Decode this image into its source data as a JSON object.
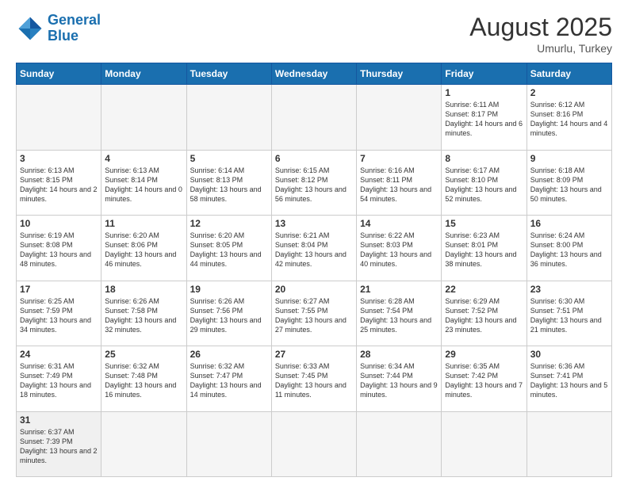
{
  "header": {
    "logo_general": "General",
    "logo_blue": "Blue",
    "month_year": "August 2025",
    "location": "Umurlu, Turkey"
  },
  "days_of_week": [
    "Sunday",
    "Monday",
    "Tuesday",
    "Wednesday",
    "Thursday",
    "Friday",
    "Saturday"
  ],
  "weeks": [
    [
      {
        "day": "",
        "info": ""
      },
      {
        "day": "",
        "info": ""
      },
      {
        "day": "",
        "info": ""
      },
      {
        "day": "",
        "info": ""
      },
      {
        "day": "",
        "info": ""
      },
      {
        "day": "1",
        "info": "Sunrise: 6:11 AM\nSunset: 8:17 PM\nDaylight: 14 hours and 6 minutes."
      },
      {
        "day": "2",
        "info": "Sunrise: 6:12 AM\nSunset: 8:16 PM\nDaylight: 14 hours and 4 minutes."
      }
    ],
    [
      {
        "day": "3",
        "info": "Sunrise: 6:13 AM\nSunset: 8:15 PM\nDaylight: 14 hours and 2 minutes."
      },
      {
        "day": "4",
        "info": "Sunrise: 6:13 AM\nSunset: 8:14 PM\nDaylight: 14 hours and 0 minutes."
      },
      {
        "day": "5",
        "info": "Sunrise: 6:14 AM\nSunset: 8:13 PM\nDaylight: 13 hours and 58 minutes."
      },
      {
        "day": "6",
        "info": "Sunrise: 6:15 AM\nSunset: 8:12 PM\nDaylight: 13 hours and 56 minutes."
      },
      {
        "day": "7",
        "info": "Sunrise: 6:16 AM\nSunset: 8:11 PM\nDaylight: 13 hours and 54 minutes."
      },
      {
        "day": "8",
        "info": "Sunrise: 6:17 AM\nSunset: 8:10 PM\nDaylight: 13 hours and 52 minutes."
      },
      {
        "day": "9",
        "info": "Sunrise: 6:18 AM\nSunset: 8:09 PM\nDaylight: 13 hours and 50 minutes."
      }
    ],
    [
      {
        "day": "10",
        "info": "Sunrise: 6:19 AM\nSunset: 8:08 PM\nDaylight: 13 hours and 48 minutes."
      },
      {
        "day": "11",
        "info": "Sunrise: 6:20 AM\nSunset: 8:06 PM\nDaylight: 13 hours and 46 minutes."
      },
      {
        "day": "12",
        "info": "Sunrise: 6:20 AM\nSunset: 8:05 PM\nDaylight: 13 hours and 44 minutes."
      },
      {
        "day": "13",
        "info": "Sunrise: 6:21 AM\nSunset: 8:04 PM\nDaylight: 13 hours and 42 minutes."
      },
      {
        "day": "14",
        "info": "Sunrise: 6:22 AM\nSunset: 8:03 PM\nDaylight: 13 hours and 40 minutes."
      },
      {
        "day": "15",
        "info": "Sunrise: 6:23 AM\nSunset: 8:01 PM\nDaylight: 13 hours and 38 minutes."
      },
      {
        "day": "16",
        "info": "Sunrise: 6:24 AM\nSunset: 8:00 PM\nDaylight: 13 hours and 36 minutes."
      }
    ],
    [
      {
        "day": "17",
        "info": "Sunrise: 6:25 AM\nSunset: 7:59 PM\nDaylight: 13 hours and 34 minutes."
      },
      {
        "day": "18",
        "info": "Sunrise: 6:26 AM\nSunset: 7:58 PM\nDaylight: 13 hours and 32 minutes."
      },
      {
        "day": "19",
        "info": "Sunrise: 6:26 AM\nSunset: 7:56 PM\nDaylight: 13 hours and 29 minutes."
      },
      {
        "day": "20",
        "info": "Sunrise: 6:27 AM\nSunset: 7:55 PM\nDaylight: 13 hours and 27 minutes."
      },
      {
        "day": "21",
        "info": "Sunrise: 6:28 AM\nSunset: 7:54 PM\nDaylight: 13 hours and 25 minutes."
      },
      {
        "day": "22",
        "info": "Sunrise: 6:29 AM\nSunset: 7:52 PM\nDaylight: 13 hours and 23 minutes."
      },
      {
        "day": "23",
        "info": "Sunrise: 6:30 AM\nSunset: 7:51 PM\nDaylight: 13 hours and 21 minutes."
      }
    ],
    [
      {
        "day": "24",
        "info": "Sunrise: 6:31 AM\nSunset: 7:49 PM\nDaylight: 13 hours and 18 minutes."
      },
      {
        "day": "25",
        "info": "Sunrise: 6:32 AM\nSunset: 7:48 PM\nDaylight: 13 hours and 16 minutes."
      },
      {
        "day": "26",
        "info": "Sunrise: 6:32 AM\nSunset: 7:47 PM\nDaylight: 13 hours and 14 minutes."
      },
      {
        "day": "27",
        "info": "Sunrise: 6:33 AM\nSunset: 7:45 PM\nDaylight: 13 hours and 11 minutes."
      },
      {
        "day": "28",
        "info": "Sunrise: 6:34 AM\nSunset: 7:44 PM\nDaylight: 13 hours and 9 minutes."
      },
      {
        "day": "29",
        "info": "Sunrise: 6:35 AM\nSunset: 7:42 PM\nDaylight: 13 hours and 7 minutes."
      },
      {
        "day": "30",
        "info": "Sunrise: 6:36 AM\nSunset: 7:41 PM\nDaylight: 13 hours and 5 minutes."
      }
    ],
    [
      {
        "day": "31",
        "info": "Sunrise: 6:37 AM\nSunset: 7:39 PM\nDaylight: 13 hours and 2 minutes."
      },
      {
        "day": "",
        "info": ""
      },
      {
        "day": "",
        "info": ""
      },
      {
        "day": "",
        "info": ""
      },
      {
        "day": "",
        "info": ""
      },
      {
        "day": "",
        "info": ""
      },
      {
        "day": "",
        "info": ""
      }
    ]
  ]
}
